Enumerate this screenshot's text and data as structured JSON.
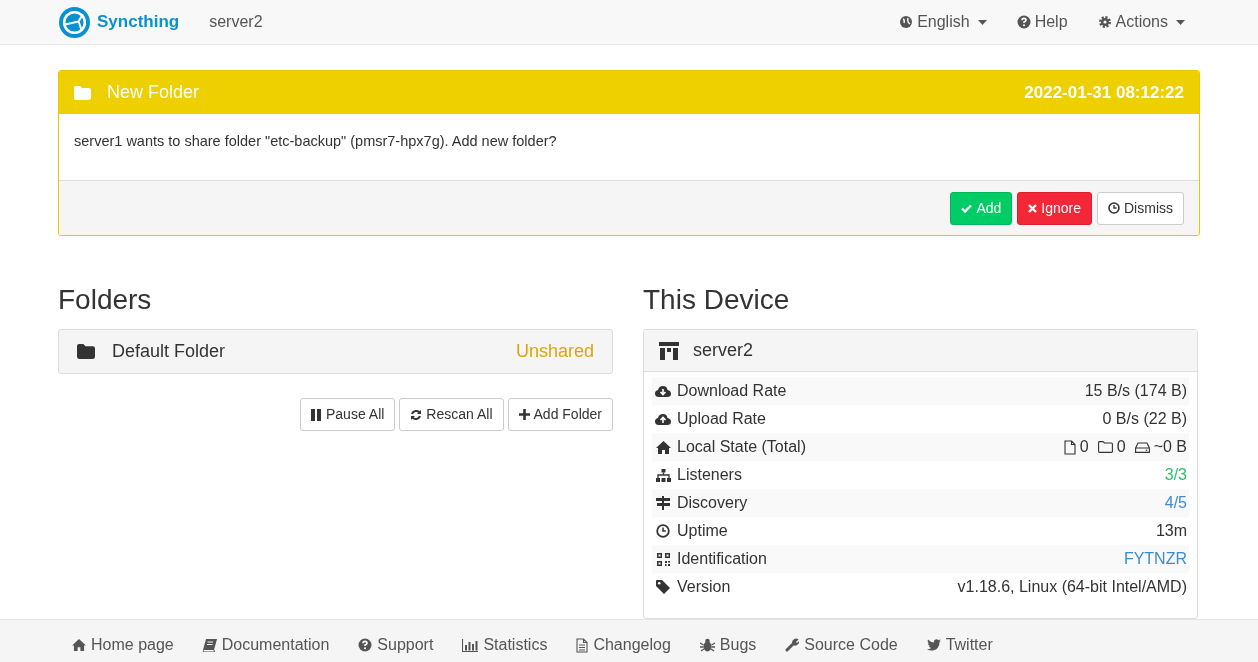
{
  "navbar": {
    "brand": "Syncthing",
    "device": "server2",
    "menus": [
      {
        "label": "English",
        "dropdown": true
      },
      {
        "label": "Help",
        "dropdown": false
      },
      {
        "label": "Actions",
        "dropdown": true
      }
    ]
  },
  "notification": {
    "title": "New Folder",
    "time": "2022-01-31 08:12:22",
    "message": "server1 wants to share folder \"etc-backup\" (pmsr7-hpx7g). Add new folder?",
    "buttons": [
      {
        "label": "Add",
        "kind": "success"
      },
      {
        "label": "Ignore",
        "kind": "danger"
      },
      {
        "label": "Dismiss",
        "kind": "default"
      }
    ]
  },
  "folders": {
    "heading": "Folders",
    "items": [
      {
        "name": "Default Folder",
        "status": "Unshared"
      }
    ],
    "buttons": [
      "Pause All",
      "Rescan All",
      "Add Folder"
    ]
  },
  "this_device": {
    "heading": "This Device",
    "name": "server2",
    "rows": [
      {
        "label": "Download Rate",
        "kind": "text",
        "value": "15 B/s (174 B)",
        "color": "#333333"
      },
      {
        "label": "Upload Rate",
        "kind": "text",
        "value": "0 B/s (22 B)",
        "color": "#333333"
      },
      {
        "label": "Local State (Total)",
        "kind": "counts",
        "values": [
          "0",
          "0",
          "~0 B"
        ],
        "color": "#333333"
      },
      {
        "label": "Listeners",
        "kind": "text",
        "value": "3/3",
        "color": "#2cc36b"
      },
      {
        "label": "Discovery",
        "kind": "text",
        "value": "4/5",
        "color": "#3c8dd0"
      },
      {
        "label": "Uptime",
        "kind": "text",
        "value": "13m",
        "color": "#333333"
      },
      {
        "label": "Identification",
        "kind": "text",
        "value": "FYTNZR",
        "color": "#3c8dd0"
      },
      {
        "label": "Version",
        "kind": "text",
        "value": "v1.18.6, Linux (64-bit Intel/AMD)",
        "color": "#333333"
      }
    ]
  },
  "footer": [
    "Home page",
    "Documentation",
    "Support",
    "Statistics",
    "Changelog",
    "Bugs",
    "Source Code",
    "Twitter"
  ]
}
